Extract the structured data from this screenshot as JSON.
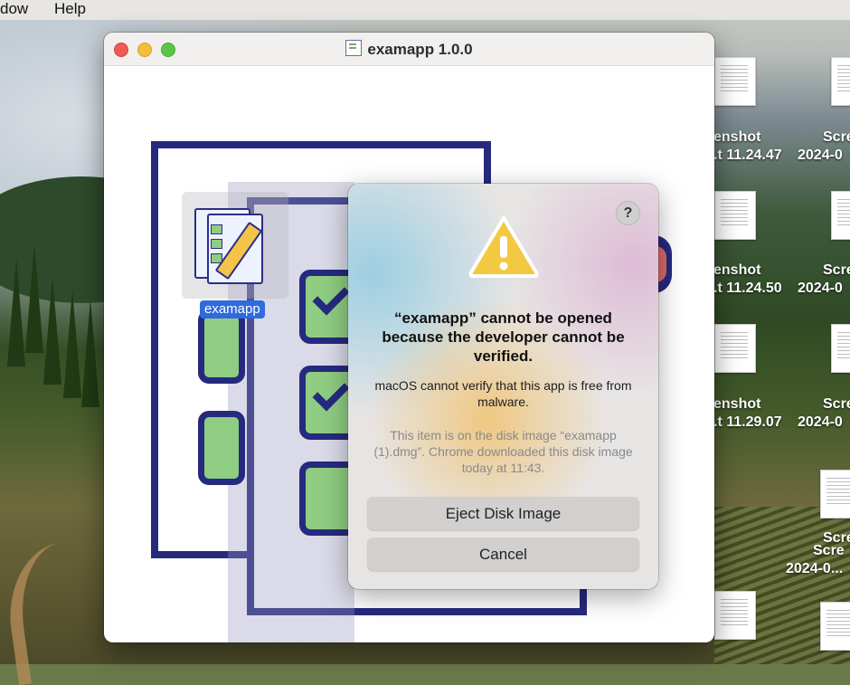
{
  "menubar": {
    "items": [
      "dow",
      "Help"
    ]
  },
  "finder": {
    "title": "examapp 1.0.0",
    "app_label": "examapp"
  },
  "desktop": {
    "items": [
      {
        "line1": "enshot",
        "line2": ".t 11.24.47"
      },
      {
        "line1": "Scre",
        "line2": "2024-0"
      },
      {
        "line1": "enshot",
        "line2": ".t 11.24.50"
      },
      {
        "line1": "Scre",
        "line2": "2024-0"
      },
      {
        "line1": "enshot",
        "line2": ".t 11.29.07"
      },
      {
        "line1": "Scre",
        "line2": "2024-0"
      },
      {
        "line1": "Scre",
        "line2": "Scre"
      },
      {
        "line1": "2024-0...",
        "line2": ""
      }
    ]
  },
  "alert": {
    "help": "?",
    "title": "“examapp” cannot be opened because the developer cannot be verified.",
    "message": "macOS cannot verify that this app is free from malware.",
    "note": "This item is on the disk image “examapp (1).dmg”. Chrome downloaded this disk image today at 11:43.",
    "buttons": {
      "eject": "Eject Disk Image",
      "cancel": "Cancel"
    }
  },
  "colors": {
    "accent": "#2f6bdc",
    "close": "#ee5b55",
    "minimize": "#f4bd3a",
    "maximize": "#5cc446",
    "warning": "#f2c940",
    "illustration_stroke": "#262a7e",
    "check_fill": "#8fcd82"
  },
  "icons": [
    "warning-icon",
    "help-icon",
    "app-icon",
    "document-icon"
  ]
}
